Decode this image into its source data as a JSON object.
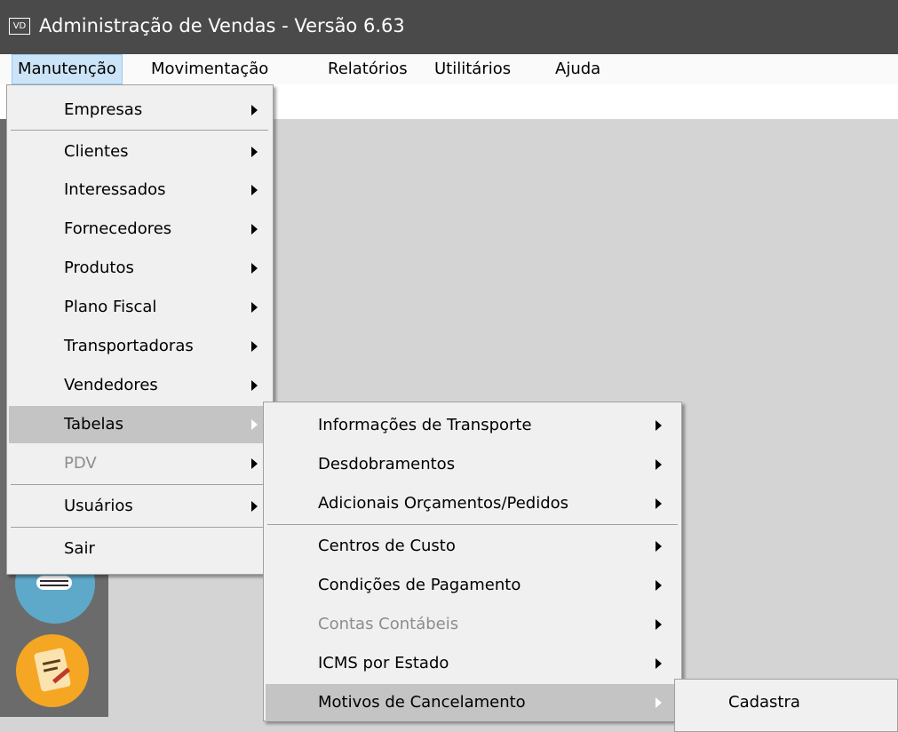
{
  "window": {
    "icon_text": "VD",
    "title": "Administração de Vendas - Versão 6.63"
  },
  "menubar": {
    "items": [
      "Manutenção",
      "Movimentação",
      "Relatórios",
      "Utilitários",
      "Ajuda"
    ],
    "active": "Manutenção"
  },
  "menu_manutencao": {
    "items": [
      {
        "label": "Empresas",
        "submenu": true
      },
      {
        "label": "Clientes",
        "submenu": true
      },
      {
        "label": "Interessados",
        "submenu": true
      },
      {
        "label": "Fornecedores",
        "submenu": true
      },
      {
        "label": "Produtos",
        "submenu": true
      },
      {
        "label": "Plano Fiscal",
        "submenu": true
      },
      {
        "label": "Transportadoras",
        "submenu": true
      },
      {
        "label": "Vendedores",
        "submenu": true
      },
      {
        "label": "Tabelas",
        "submenu": true,
        "highlighted": true
      },
      {
        "label": "PDV",
        "submenu": true,
        "disabled": true
      },
      {
        "label": "Usuários",
        "submenu": true
      },
      {
        "label": "Sair",
        "submenu": false
      }
    ]
  },
  "menu_tabelas": {
    "items": [
      {
        "label": "Informações de Transporte",
        "submenu": true
      },
      {
        "label": "Desdobramentos",
        "submenu": true
      },
      {
        "label": "Adicionais Orçamentos/Pedidos",
        "submenu": true
      },
      {
        "label": "Centros de Custo",
        "submenu": true
      },
      {
        "label": "Condições de Pagamento",
        "submenu": true
      },
      {
        "label": "Contas Contábeis",
        "submenu": true,
        "disabled": true
      },
      {
        "label": "ICMS por Estado",
        "submenu": true
      },
      {
        "label": "Motivos de Cancelamento",
        "submenu": true,
        "highlighted": true
      }
    ]
  },
  "menu_motivos": {
    "items": [
      {
        "label": "Cadastra",
        "submenu": false
      }
    ]
  },
  "colors": {
    "titlebar": "#4a4a4a",
    "menubar_active": "#cce4f7",
    "menu_bg": "#f0f0f0",
    "menu_highlight": "#c4c4c4",
    "sidepanel": "#6b6b6b"
  },
  "sidepanel_icons": [
    "list-app-icon",
    "notes-app-icon"
  ]
}
